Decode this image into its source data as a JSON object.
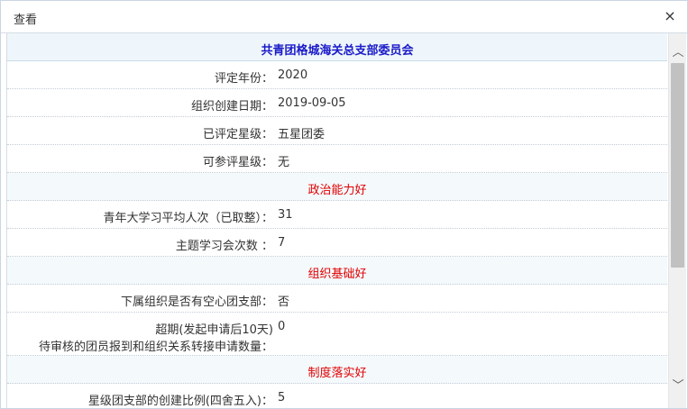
{
  "dialog": {
    "title": "查看",
    "close_glyph": "×"
  },
  "header": {
    "title": "共青团格城海关总支部委员会"
  },
  "rows": [
    {
      "label": "评定年份：",
      "value": "2020"
    },
    {
      "label": "组织创建日期：",
      "value": "2019-09-05"
    },
    {
      "label": "已评定星级：",
      "value": "五星团委"
    },
    {
      "label": "可参评星级：",
      "value": "无"
    }
  ],
  "section1": {
    "title": "政治能力好",
    "rows": [
      {
        "label": "青年大学习平均人次（已取整）：",
        "value": "31"
      },
      {
        "label": "主题学习会次数 ：",
        "value": "7"
      }
    ]
  },
  "section2": {
    "title": "组织基础好",
    "rows": [
      {
        "label": "下属组织是否有空心团支部：",
        "value": "否"
      },
      {
        "label_line1": "超期(发起申请后10天)",
        "label_line2": "待审核的团员报到和组织关系转接申请数量：",
        "value": "0"
      }
    ]
  },
  "section3": {
    "title": "制度落实好",
    "rows": [
      {
        "label": "星级团支部的创建比例(四舍五入)：",
        "value": "5"
      }
    ]
  },
  "scrollbar": {
    "up_glyph": "︿",
    "down_glyph": "﹀"
  }
}
